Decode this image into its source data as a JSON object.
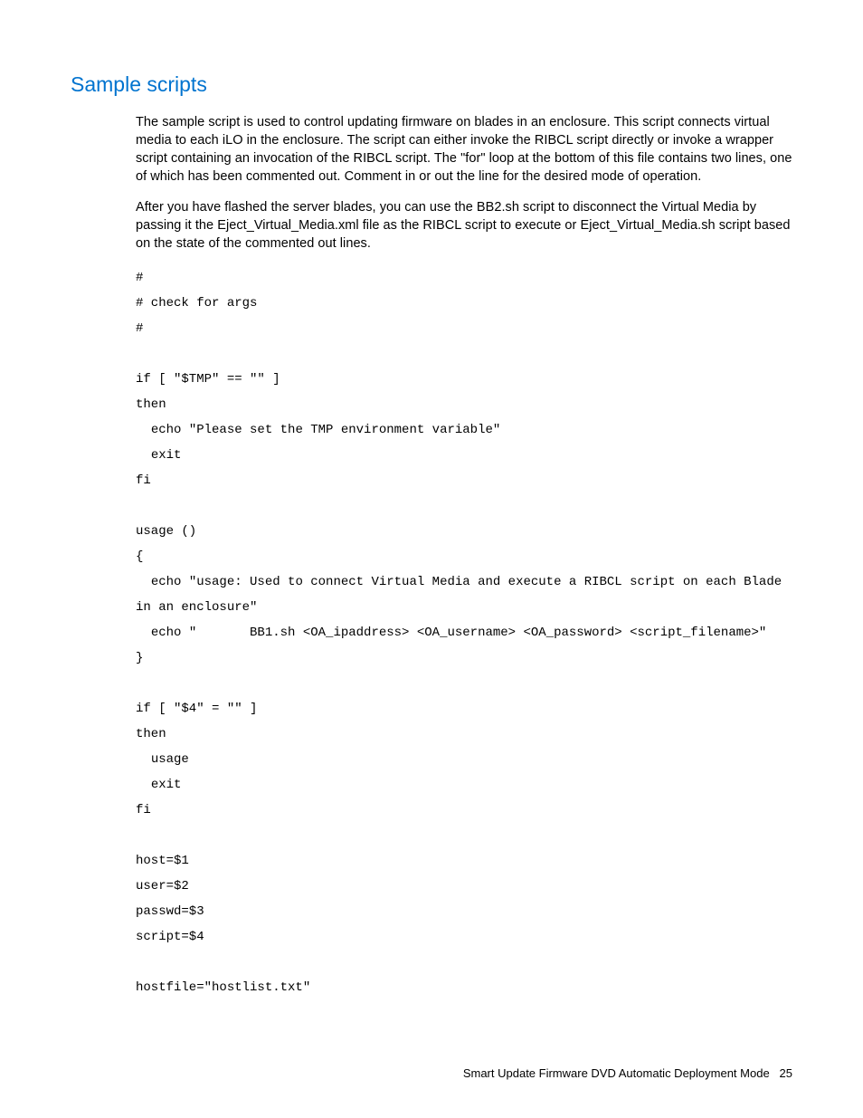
{
  "heading": "Sample scripts",
  "para1": "The sample script is used to control updating firmware on blades in an enclosure. This script connects virtual media to each iLO in the enclosure. The script can either invoke the RIBCL script directly or invoke a wrapper script containing an invocation of the RIBCL script. The \"for\" loop at the bottom of this file contains two lines, one of which has been commented out. Comment in or out the line for the desired mode of operation.",
  "para2": "After you have flashed the server blades, you can use the BB2.sh script to disconnect the Virtual Media by passing it the Eject_Virtual_Media.xml file as the RIBCL script to execute or Eject_Virtual_Media.sh script based on the state of the commented out lines.",
  "code": "#\n# check for args\n#\n\nif [ \"$TMP\" == \"\" ]\nthen\n  echo \"Please set the TMP environment variable\"\n  exit\nfi\n\nusage ()\n{\n  echo \"usage: Used to connect Virtual Media and execute a RIBCL script on each Blade in an enclosure\"\n  echo \"       BB1.sh <OA_ipaddress> <OA_username> <OA_password> <script_filename>\"\n}\n\nif [ \"$4\" = \"\" ]\nthen\n  usage\n  exit\nfi\n\nhost=$1\nuser=$2\npasswd=$3\nscript=$4\n\nhostfile=\"hostlist.txt\"",
  "footer_text": "Smart Update Firmware DVD Automatic Deployment Mode",
  "footer_page": "25"
}
